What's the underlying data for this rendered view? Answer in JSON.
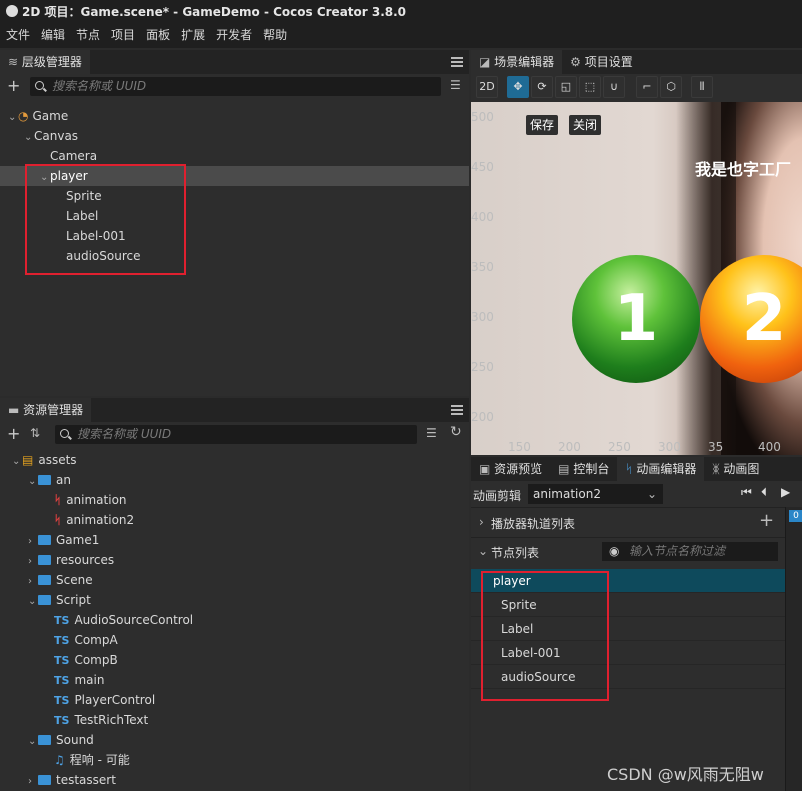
{
  "window": {
    "title": "2D 项目：Game.scene* - GameDemo - Cocos Creator 3.8.0"
  },
  "menu": [
    "文件",
    "编辑",
    "节点",
    "项目",
    "面板",
    "扩展",
    "开发者",
    "帮助"
  ],
  "hierarchy": {
    "title": "层级管理器",
    "search_placeholder": "搜索名称或 UUID",
    "nodes": [
      {
        "label": "Game",
        "depth": 0,
        "arrow": "v"
      },
      {
        "label": "Canvas",
        "depth": 1,
        "arrow": "v"
      },
      {
        "label": "Camera",
        "depth": 2,
        "arrow": ""
      },
      {
        "label": "player",
        "depth": 2,
        "arrow": "v"
      },
      {
        "label": "Sprite",
        "depth": 3,
        "arrow": ""
      },
      {
        "label": "Label",
        "depth": 3,
        "arrow": ""
      },
      {
        "label": "Label-001",
        "depth": 3,
        "arrow": ""
      },
      {
        "label": "audioSource",
        "depth": 3,
        "arrow": ""
      }
    ]
  },
  "assets": {
    "title": "资源管理器",
    "search_placeholder": "搜索名称或 UUID",
    "items": [
      {
        "label": "assets",
        "depth": 0,
        "arrow": "v",
        "icon": "db"
      },
      {
        "label": "an",
        "depth": 1,
        "arrow": "v",
        "icon": "folder-open"
      },
      {
        "label": "animation",
        "depth": 2,
        "arrow": "",
        "icon": "anim"
      },
      {
        "label": "animation2",
        "depth": 2,
        "arrow": "",
        "icon": "anim"
      },
      {
        "label": "Game1",
        "depth": 1,
        "arrow": ">",
        "icon": "folder"
      },
      {
        "label": "resources",
        "depth": 1,
        "arrow": ">",
        "icon": "folder"
      },
      {
        "label": "Scene",
        "depth": 1,
        "arrow": ">",
        "icon": "folder"
      },
      {
        "label": "Script",
        "depth": 1,
        "arrow": "v",
        "icon": "folder-open"
      },
      {
        "label": "AudioSourceControl",
        "depth": 2,
        "arrow": "",
        "icon": "ts"
      },
      {
        "label": "CompA",
        "depth": 2,
        "arrow": "",
        "icon": "ts"
      },
      {
        "label": "CompB",
        "depth": 2,
        "arrow": "",
        "icon": "ts"
      },
      {
        "label": "main",
        "depth": 2,
        "arrow": "",
        "icon": "ts"
      },
      {
        "label": "PlayerControl",
        "depth": 2,
        "arrow": "",
        "icon": "ts"
      },
      {
        "label": "TestRichText",
        "depth": 2,
        "arrow": "",
        "icon": "ts"
      },
      {
        "label": "Sound",
        "depth": 1,
        "arrow": "v",
        "icon": "folder-open"
      },
      {
        "label": "程响 - 可能",
        "depth": 2,
        "arrow": "",
        "icon": "music"
      },
      {
        "label": "testassert",
        "depth": 1,
        "arrow": ">",
        "icon": "folder"
      }
    ]
  },
  "scene": {
    "tabs": [
      "场景编辑器",
      "项目设置"
    ],
    "mode_2d": "2D",
    "buttons": {
      "save": "保存",
      "close": "关闭"
    },
    "y_ticks": [
      "500",
      "450",
      "400",
      "350",
      "300",
      "250",
      "200"
    ],
    "x_ticks": [
      "150",
      "200",
      "250",
      "300",
      "35",
      "400"
    ],
    "banner_text": "我是也字工厂",
    "ball1": "1",
    "ball2": "2"
  },
  "bottom": {
    "tabs": [
      "资源预览",
      "控制台",
      "动画编辑器",
      "动画图"
    ],
    "clip_label": "动画剪辑",
    "clip_value": "animation2",
    "track_list": "播放器轨道列表",
    "node_list": "节点列表",
    "filter_placeholder": "输入节点名称过滤",
    "nodes": [
      "player",
      "Sprite",
      "Label",
      "Label-001",
      "audioSource"
    ],
    "timeline_marker": "0"
  },
  "watermark": "CSDN @w风雨无阻w"
}
